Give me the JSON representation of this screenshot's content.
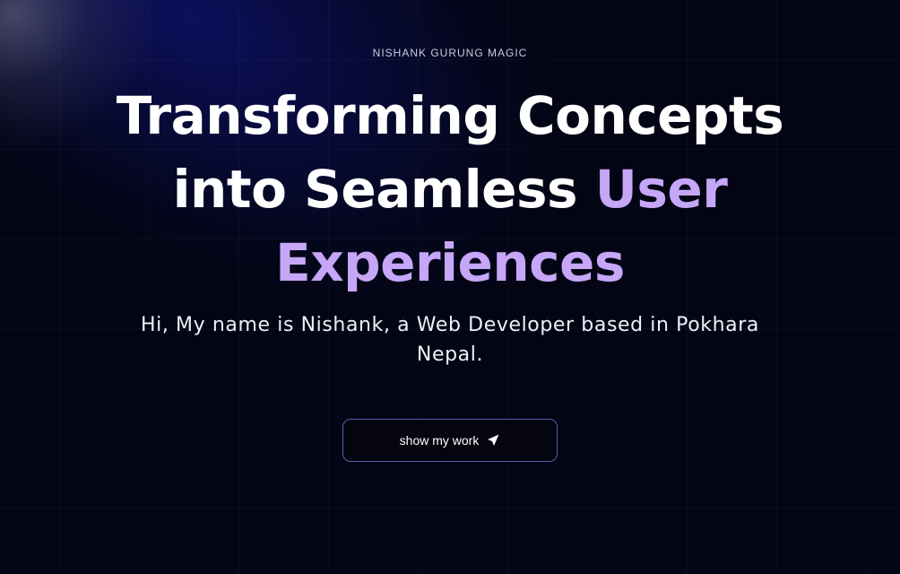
{
  "hero": {
    "eyebrow": "NISHANK GURUNG MAGIC",
    "headline": {
      "line1": "Transforming Concepts",
      "line2_plain": "into Seamless ",
      "line2_accent": "User",
      "line3_accent": "Experiences"
    },
    "subtitle": "Hi, My name is Nishank, a Web Developer based in Pokhara Nepal.",
    "cta": {
      "label": "show my work",
      "icon": "send-icon"
    }
  },
  "colors": {
    "background": "#030514",
    "accent": "#c6a6f7",
    "text": "#ffffff",
    "button_border": "#5c5aa8"
  }
}
